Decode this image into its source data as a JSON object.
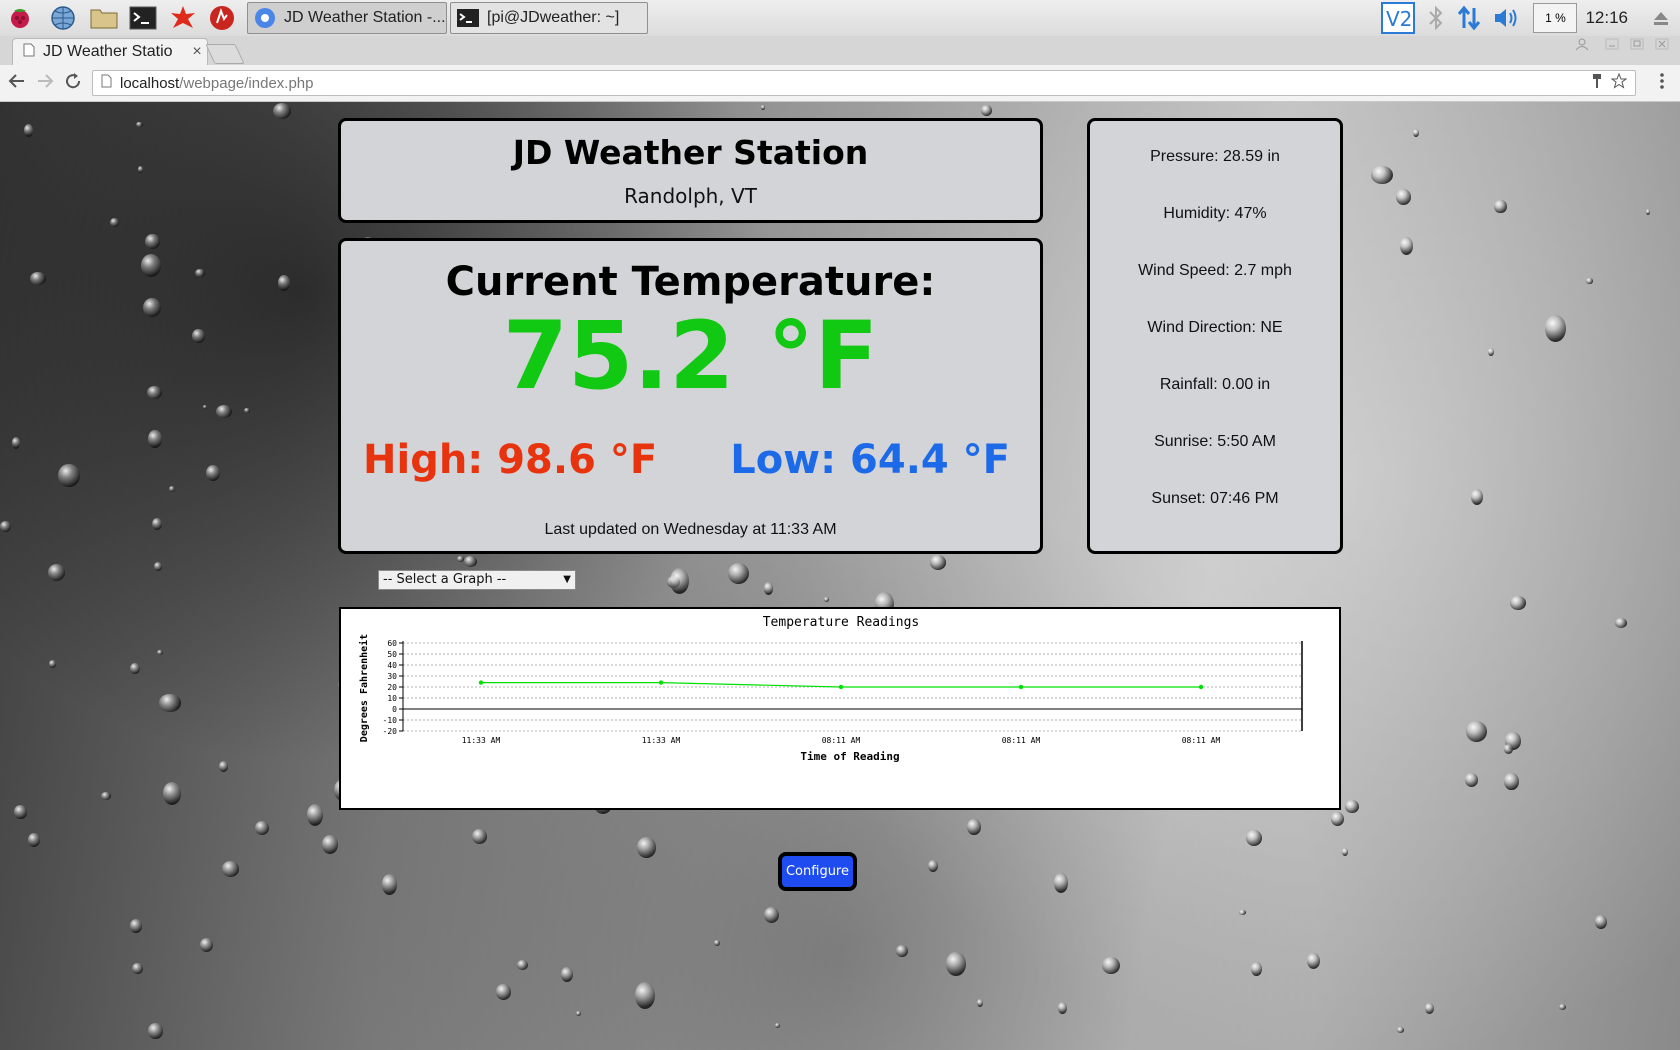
{
  "taskbar": {
    "tasks": [
      {
        "label": "JD Weather Station -..."
      },
      {
        "label": "[pi@JDweather: ~]"
      }
    ],
    "cpu": "1 %",
    "clock": "12:16"
  },
  "browser": {
    "tab_title": "JD Weather Statio",
    "tab_close": "×",
    "url_host": "localhost",
    "url_path": "/webpage/index.php"
  },
  "station": {
    "name": "JD Weather Station",
    "location": "Randolph, VT"
  },
  "current": {
    "label": "Current Temperature:",
    "value": "75.2 °F",
    "high": "High: 98.6 °F",
    "low": "Low: 64.4 °F",
    "updated": "Last updated on Wednesday at 11:33 AM"
  },
  "stats": [
    "Pressure: 28.59 in",
    "Humidity: 47%",
    "Wind Speed: 2.7 mph",
    "Wind Direction: NE",
    "Rainfall: 0.00 in",
    "Sunrise: 5:50 AM",
    "Sunset: 07:46 PM"
  ],
  "graph_select": {
    "selected": "-- Select a Graph --"
  },
  "configure_label": "Configure",
  "colors": {
    "current": "#11c912",
    "high": "#e8330f",
    "low": "#1d6ae8",
    "line": "#00e000",
    "button": "#1e4cf0"
  },
  "chart_data": {
    "type": "line",
    "title": "Temperature Readings",
    "xlabel": "Time of Reading",
    "ylabel": "Degrees Fahrenheit",
    "ylim": [
      -20,
      60
    ],
    "yticks": [
      60,
      50,
      40,
      30,
      20,
      10,
      0,
      -10,
      -20
    ],
    "grid": true,
    "categories": [
      "11:33 AM",
      "11:33 AM",
      "08:11 AM",
      "08:11 AM",
      "08:11 AM"
    ],
    "series": [
      {
        "values": [
          24,
          24,
          20,
          20,
          20
        ]
      }
    ]
  }
}
